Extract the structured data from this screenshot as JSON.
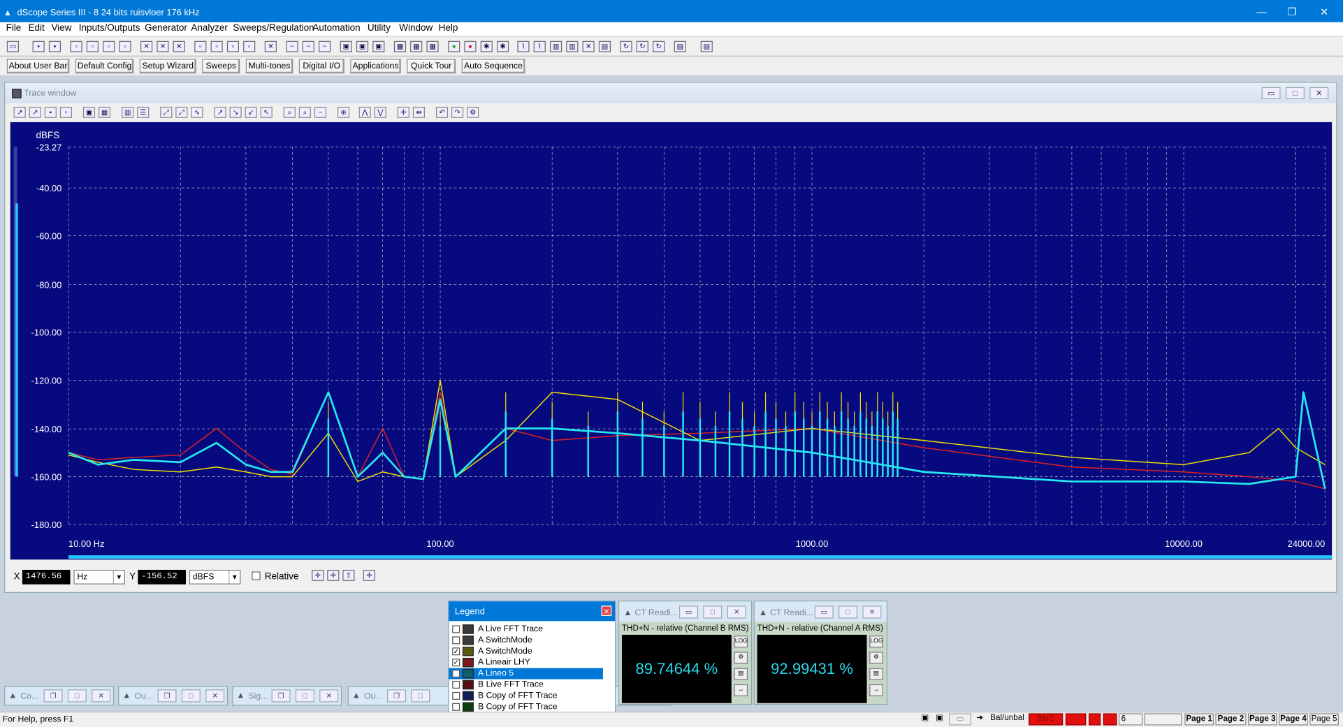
{
  "titlebar": {
    "title": "dScope Series III - 8 24 bits ruisvloer 176 kHz",
    "minimize": "—",
    "restore": "❐",
    "close": "✕"
  },
  "menu": [
    "File",
    "Edit",
    "View",
    "Inputs/Outputs",
    "Generator",
    "Analyzer",
    "Sweeps/Regulation",
    "Automation",
    "Utility",
    "Window",
    "Help"
  ],
  "userbar": [
    "About User Bar",
    "Default Config",
    "Setup Wizard",
    "Sweeps",
    "Multi-tones",
    "Digital I/O",
    "Applications",
    "Quick Tour",
    "Auto Sequence"
  ],
  "trace_window": {
    "title": "Trace window"
  },
  "chart_data": {
    "type": "line",
    "title": "",
    "ylabel": "dBFS",
    "xlabel": "",
    "x_scale": "log",
    "xlim": [
      10,
      24000
    ],
    "ylim": [
      -180,
      -123.27
    ],
    "x_tick_labels": [
      "10.00 Hz",
      "100.00",
      "1000.00",
      "10000.00",
      "24000.00"
    ],
    "x_ticks": [
      10,
      100,
      1000,
      10000,
      24000
    ],
    "y_tick_labels": [
      "-23.27",
      "-40.00",
      "-60.00",
      "-80.00",
      "-100.00",
      "-120.00",
      "-140.00",
      "-160.00",
      "-180.00"
    ],
    "y_ticks": [
      -123.27,
      -140,
      -160,
      -180,
      -200,
      -220,
      -240,
      -260,
      -280
    ],
    "grid": true,
    "colors": {
      "background": "#070a7e",
      "grid": "#b8b8c8",
      "text": "#ffffff",
      "axis_label": "#26c6ff"
    },
    "series": [
      {
        "name": "A Lineair LHY",
        "color": "#e02020",
        "x": [
          10,
          12,
          15,
          20,
          25,
          30,
          35,
          40,
          50,
          60,
          70,
          80,
          90,
          100,
          110,
          150,
          200,
          300,
          500,
          1000,
          2000,
          5000,
          10000,
          15000,
          20000,
          24000
        ],
        "y": [
          -150,
          -153,
          -152,
          -151,
          -140,
          -150,
          -157,
          -159,
          -125,
          -160,
          -140,
          -160,
          -161,
          -125,
          -160,
          -140,
          -145,
          -143,
          -142,
          -140,
          -148,
          -156,
          -158,
          -160,
          -162,
          -165
        ]
      },
      {
        "name": "A SwitchMode",
        "color": "#f0e000",
        "x": [
          10,
          12,
          15,
          20,
          25,
          30,
          35,
          40,
          50,
          60,
          70,
          80,
          90,
          100,
          110,
          150,
          200,
          300,
          500,
          1000,
          2000,
          5000,
          10000,
          15000,
          18000,
          20000,
          24000
        ],
        "y": [
          -151,
          -154,
          -157,
          -158,
          -156,
          -158,
          -160,
          -160,
          -142,
          -162,
          -158,
          -160,
          -161,
          -120,
          -160,
          -145,
          -125,
          -128,
          -145,
          -140,
          -145,
          -152,
          -155,
          -150,
          -140,
          -148,
          -155
        ]
      },
      {
        "name": "A Lineo 5",
        "color": "#26e8f0",
        "x": [
          10,
          12,
          15,
          20,
          25,
          30,
          35,
          40,
          50,
          60,
          70,
          80,
          90,
          100,
          110,
          150,
          200,
          300,
          500,
          1000,
          2000,
          5000,
          10000,
          15000,
          20000,
          21000,
          24000
        ],
        "y": [
          -150,
          -155,
          -153,
          -154,
          -146,
          -155,
          -158,
          -158,
          -125,
          -160,
          -150,
          -160,
          -161,
          -128,
          -160,
          -140,
          -140,
          -142,
          -145,
          -150,
          -158,
          -162,
          -162,
          -163,
          -160,
          -125,
          -165
        ]
      }
    ]
  },
  "cursor": {
    "x_label": "X",
    "x_value": "1476.56",
    "x_unit": "Hz",
    "y_label": "Y",
    "y_value": "-156.52",
    "y_unit": "dBFS",
    "relative": "Relative"
  },
  "legend": {
    "title": "Legend",
    "items": [
      {
        "label": "A Live FFT Trace",
        "checked": false,
        "swatch": "#3b3b3b"
      },
      {
        "label": "A SwitchMode",
        "checked": false,
        "swatch": "#3b3b3b"
      },
      {
        "label": "A SwitchMode",
        "checked": true,
        "swatch": "#5a5a10"
      },
      {
        "label": "A Lineair LHY",
        "checked": true,
        "swatch": "#7a1a1a"
      },
      {
        "label": "A Lineo 5",
        "checked": true,
        "swatch": "#106070"
      },
      {
        "label": "B Live FFT Trace",
        "checked": false,
        "swatch": "#5a1010"
      },
      {
        "label": "B Copy of FFT Trace",
        "checked": false,
        "swatch": "#10205a"
      },
      {
        "label": "B Copy of FFT Trace",
        "checked": false,
        "swatch": "#104010"
      }
    ]
  },
  "readings": [
    {
      "title": "CT Readi...",
      "subtitle": "THD+N - relative (Channel B RMS)",
      "value": "89.74644 %"
    },
    {
      "title": "CT Readi...",
      "subtitle": "THD+N - relative (Channel A RMS)",
      "value": "92.99431 %"
    }
  ],
  "minimized": [
    "Co...",
    "Ou...",
    "Sig...",
    "Ou..."
  ],
  "status": {
    "help": "For Help, press F1",
    "balance": "Bal/unbal",
    "bnc": "BNC",
    "six": "6",
    "pages": [
      "Page 1",
      "Page 2",
      "Page 3",
      "Page 4",
      "Page 5"
    ]
  }
}
